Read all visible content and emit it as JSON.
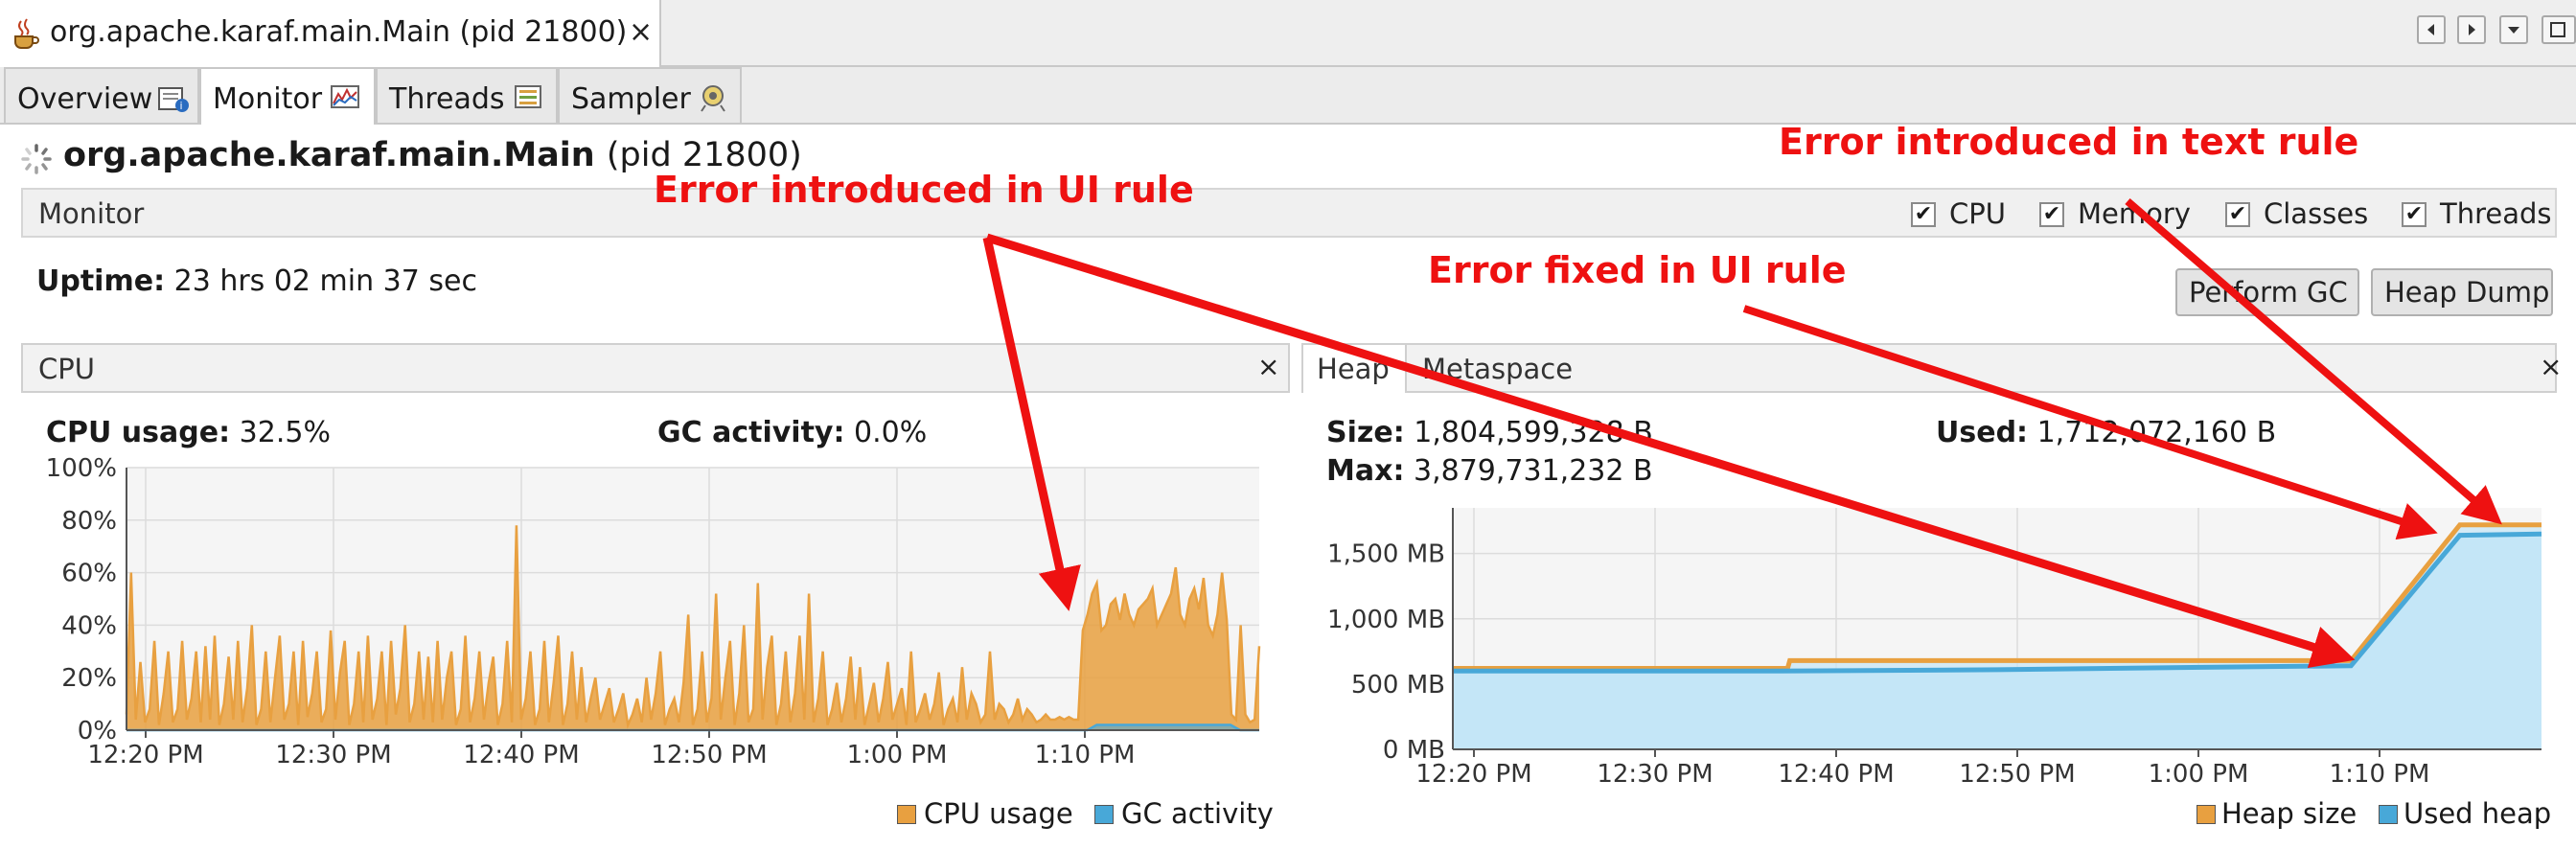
{
  "window": {
    "title": "org.apache.karaf.main.Main (pid 21800)",
    "close": "×",
    "tabs": [
      "Overview",
      "Monitor",
      "Threads",
      "Sampler"
    ]
  },
  "header": {
    "app_name": "org.apache.karaf.main.Main",
    "pid": "(pid 21800)",
    "section": "Monitor",
    "checkboxes": [
      "CPU",
      "Memory",
      "Classes",
      "Threads"
    ],
    "uptime_label": "Uptime:",
    "uptime_value": "23 hrs 02 min 37 sec",
    "gc_button": "Perform GC",
    "heapdump_button": "Heap Dump"
  },
  "cpu_panel": {
    "title": "CPU",
    "close": "×",
    "usage_label": "CPU usage:",
    "usage_value": "32.5%",
    "gc_label": "GC activity:",
    "gc_value": "0.0%",
    "legend": [
      "CPU usage",
      "GC activity"
    ]
  },
  "heap_panel": {
    "tabs": [
      "Heap",
      "Metaspace"
    ],
    "close": "×",
    "size_label": "Size:",
    "size_value": "1,804,599,328 B",
    "max_label": "Max:",
    "max_value": "3,879,731,232 B",
    "used_label": "Used:",
    "used_value": "1,712,072,160 B",
    "legend": [
      "Heap size",
      "Used heap"
    ]
  },
  "annotations": {
    "text_rule": "Error introduced in text rule",
    "ui_rule": "Error introduced in UI rule",
    "fixed": "Error fixed in UI rule"
  },
  "colors": {
    "cpu": "#e8a040",
    "gc": "#48a8d8",
    "heap_fill": "#c4e6f7",
    "annotation": "#ee1111"
  },
  "chart_data": [
    {
      "type": "area",
      "x_ticks": [
        "12:20 PM",
        "12:30 PM",
        "12:40 PM",
        "12:50 PM",
        "1:00 PM",
        "1:10 PM"
      ],
      "y_ticks": [
        "100%",
        "80%",
        "60%",
        "40%",
        "20%",
        "0%"
      ],
      "ylim": [
        0,
        100
      ],
      "series": [
        {
          "name": "CPU usage",
          "color": "#e8a040",
          "values": [
            6,
            60,
            4,
            26,
            3,
            8,
            34,
            2,
            14,
            30,
            3,
            8,
            34,
            4,
            12,
            30,
            3,
            32,
            4,
            36,
            2,
            10,
            28,
            4,
            34,
            3,
            16,
            40,
            2,
            8,
            30,
            3,
            20,
            36,
            4,
            10,
            30,
            2,
            34,
            5,
            14,
            30,
            3,
            8,
            38,
            4,
            22,
            34,
            2,
            10,
            30,
            3,
            36,
            4,
            12,
            30,
            2,
            34,
            6,
            16,
            40,
            3,
            10,
            30,
            4,
            28,
            3,
            34,
            4,
            20,
            30,
            2,
            8,
            36,
            3,
            12,
            30,
            4,
            18,
            28,
            2,
            10,
            34,
            3,
            78,
            4,
            12,
            30,
            2,
            8,
            34,
            3,
            18,
            36,
            2,
            10,
            30,
            4,
            24,
            3,
            12,
            20,
            4,
            10,
            16,
            3,
            8,
            14,
            2,
            6,
            12,
            3,
            20,
            4,
            14,
            30,
            2,
            8,
            12,
            3,
            18,
            44,
            2,
            8,
            30,
            3,
            12,
            52,
            4,
            20,
            34,
            2,
            14,
            40,
            3,
            8,
            56,
            4,
            24,
            36,
            2,
            10,
            30,
            3,
            14,
            36,
            4,
            52,
            3,
            12,
            30,
            2,
            8,
            18,
            3,
            12,
            28,
            4,
            24,
            2,
            10,
            18,
            3,
            12,
            26,
            4,
            10,
            16,
            2,
            30,
            3,
            8,
            14,
            4,
            10,
            22,
            2,
            8,
            12,
            3,
            24,
            4,
            14,
            10,
            3,
            6,
            30,
            4,
            10,
            8,
            3,
            6,
            12,
            4,
            8,
            6,
            3,
            4,
            6,
            4,
            4,
            5,
            4,
            5,
            4,
            4,
            38,
            44,
            52,
            56,
            38,
            40,
            48,
            50,
            42,
            52,
            44,
            40,
            46,
            48,
            50,
            54,
            40,
            44,
            48,
            52,
            62,
            44,
            40,
            50,
            54,
            46,
            58,
            40,
            36,
            44,
            60,
            42,
            6,
            4,
            40,
            6,
            3,
            4,
            32
          ]
        },
        {
          "name": "GC activity",
          "color": "#48a8d8",
          "values": [
            0,
            0,
            0,
            0,
            0,
            0,
            0,
            0,
            0,
            0,
            0,
            0,
            0,
            0,
            0,
            0,
            0,
            0,
            0,
            0,
            0,
            0,
            0,
            0,
            0,
            0,
            0,
            0,
            0,
            0,
            0,
            0,
            0,
            0,
            0,
            0,
            0,
            0,
            0,
            0,
            0,
            0,
            0,
            0,
            0,
            0,
            0,
            0,
            0,
            0,
            0,
            0,
            0,
            0,
            0,
            0,
            0,
            0,
            0,
            0,
            0,
            0,
            0,
            0,
            0,
            0,
            0,
            0,
            0,
            0,
            0,
            0,
            0,
            0,
            0,
            0,
            0,
            0,
            0,
            0,
            0,
            0,
            0,
            0,
            0,
            0,
            0,
            0,
            0,
            0,
            0,
            0,
            0,
            0,
            0,
            0,
            0,
            0,
            0,
            0,
            0,
            0,
            0,
            0,
            0,
            0,
            0,
            0,
            0,
            0,
            0,
            0,
            0,
            0,
            0,
            0,
            0,
            0,
            0,
            0,
            0,
            0,
            0,
            0,
            0,
            0,
            0,
            0,
            0,
            0,
            0,
            0,
            0,
            0,
            0,
            0,
            0,
            0,
            0,
            0,
            0,
            0,
            0,
            0,
            0,
            0,
            0,
            0,
            0,
            0,
            0,
            0,
            0,
            0,
            0,
            0,
            0,
            0,
            0,
            0,
            0,
            0,
            0,
            0,
            0,
            0,
            0,
            0,
            0,
            0,
            0,
            0,
            0,
            0,
            0,
            0,
            0,
            0,
            0,
            0,
            0,
            0,
            0,
            0,
            0,
            0,
            0,
            0,
            0,
            0,
            0,
            0,
            0,
            0,
            0,
            0,
            0,
            0,
            0,
            0,
            0,
            0,
            1,
            2,
            2,
            2,
            2,
            2,
            2,
            2,
            2,
            2,
            2,
            2,
            2,
            2,
            2,
            2,
            2,
            2,
            2,
            2,
            2,
            2,
            2,
            2,
            2,
            2,
            2,
            2,
            2,
            2,
            1,
            0,
            0,
            0,
            0,
            0
          ]
        }
      ],
      "legend": "bottom-right",
      "grid": true
    },
    {
      "type": "area",
      "x_ticks": [
        "12:20 PM",
        "12:30 PM",
        "12:40 PM",
        "12:50 PM",
        "1:00 PM",
        "1:10 PM"
      ],
      "y_ticks": [
        "1,500 MB",
        "1,000 MB",
        "500 MB",
        "0 MB"
      ],
      "ylim": [
        0,
        1850
      ],
      "series": [
        {
          "name": "Heap size",
          "color": "#e8a040",
          "points": [
            [
              0,
              620
            ],
            [
              0.3075,
              620
            ],
            [
              0.3095,
              680
            ],
            [
              0.825,
              680
            ],
            [
              0.925,
              1720
            ],
            [
              1,
              1720
            ]
          ]
        },
        {
          "name": "Used heap",
          "color": "#48a8d8",
          "points": [
            [
              0,
              600
            ],
            [
              0.3,
              600
            ],
            [
              0.5,
              610
            ],
            [
              0.7,
              630
            ],
            [
              0.825,
              640
            ],
            [
              0.925,
              1640
            ],
            [
              1,
              1650
            ]
          ]
        }
      ],
      "legend": "bottom-right",
      "grid": true
    }
  ]
}
